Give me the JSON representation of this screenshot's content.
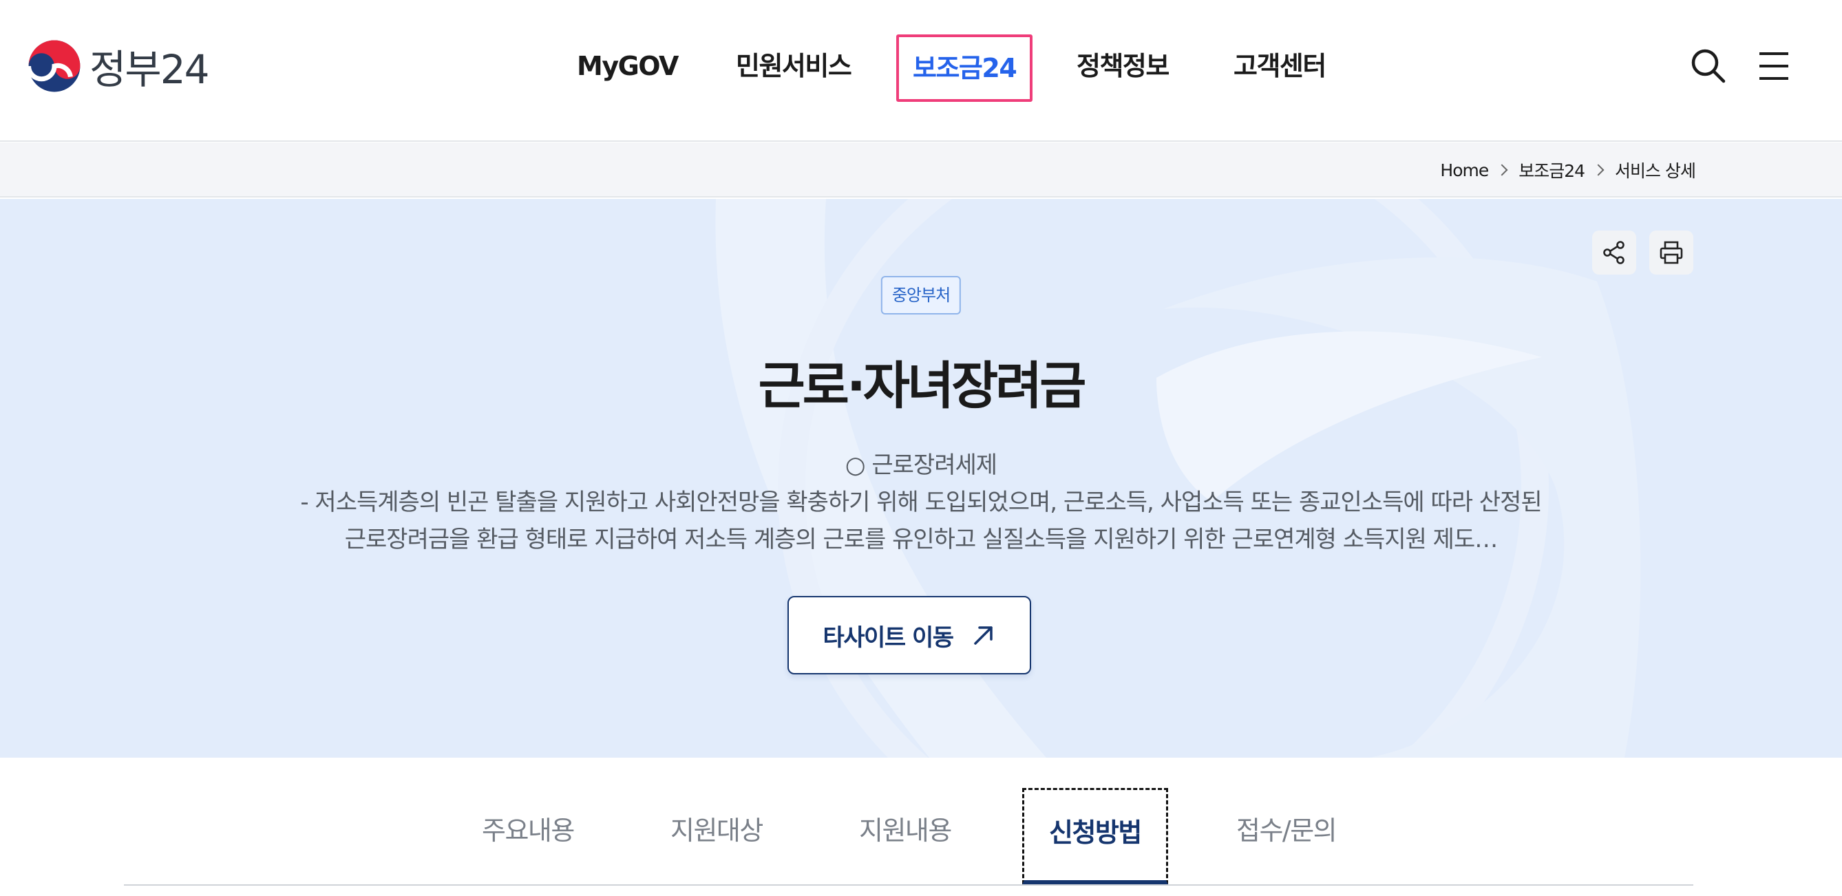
{
  "header": {
    "logo_text": "정부24",
    "nav": [
      {
        "label": "MyGOV",
        "active": false
      },
      {
        "label": "민원서비스",
        "active": false
      },
      {
        "label": "보조금24",
        "active": true
      },
      {
        "label": "정책정보",
        "active": false
      },
      {
        "label": "고객센터",
        "active": false
      }
    ],
    "icons": [
      "search-icon",
      "menu-icon"
    ]
  },
  "breadcrumb": [
    "Home",
    "보조금24",
    "서비스 상세"
  ],
  "hero": {
    "badge": "중앙부처",
    "title": "근로·자녀장려금",
    "desc_lines": [
      "○ 근로장려세제",
      "- 저소득계층의 빈곤 탈출을 지원하고 사회안전망을 확충하기 위해 도입되었으며, 근로소득, 사업소득 또는 종교인소득에 따라 산정된",
      "근로장려금을 환급 형태로 지급하여 저소득 계층의 근로를 유인하고 실질소득을 지원하기 위한 근로연계형 소득지원 제도…"
    ],
    "button_label": "타사이트 이동",
    "util_icons": [
      "share-icon",
      "print-icon"
    ]
  },
  "tabs": [
    {
      "label": "주요내용",
      "active": false
    },
    {
      "label": "지원대상",
      "active": false
    },
    {
      "label": "지원내용",
      "active": false
    },
    {
      "label": "신청방법",
      "active": true
    },
    {
      "label": "접수/문의",
      "active": false
    }
  ],
  "colors": {
    "accent": "#2563eb",
    "navy": "#15356e",
    "hero_bg": "#e2ecfb",
    "focus_outline": "#ef3d7a"
  }
}
